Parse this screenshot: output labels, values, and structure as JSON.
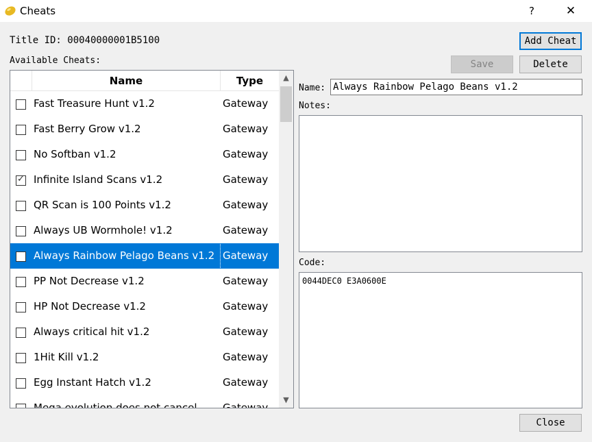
{
  "window": {
    "title": "Cheats",
    "help_glyph": "?",
    "close_glyph": "✕"
  },
  "title_id": "Title ID: 00040000001B5100",
  "available_label": "Available Cheats:",
  "buttons": {
    "add": "Add Cheat",
    "save": "Save",
    "delete": "Delete",
    "close": "Close"
  },
  "columns": {
    "name": "Name",
    "type": "Type"
  },
  "cheats": [
    {
      "name": "Fast Treasure Hunt v1.2",
      "type": "Gateway",
      "checked": false,
      "selected": false
    },
    {
      "name": "Fast Berry Grow v1.2",
      "type": "Gateway",
      "checked": false,
      "selected": false
    },
    {
      "name": "No Softban v1.2",
      "type": "Gateway",
      "checked": false,
      "selected": false
    },
    {
      "name": "Infinite Island Scans v1.2",
      "type": "Gateway",
      "checked": true,
      "selected": false
    },
    {
      "name": "QR Scan is 100 Points v1.2",
      "type": "Gateway",
      "checked": false,
      "selected": false
    },
    {
      "name": "Always UB Wormhole! v1.2",
      "type": "Gateway",
      "checked": false,
      "selected": false
    },
    {
      "name": "Always Rainbow Pelago Beans v1.2",
      "type": "Gateway",
      "checked": false,
      "selected": true
    },
    {
      "name": "PP Not Decrease v1.2",
      "type": "Gateway",
      "checked": false,
      "selected": false
    },
    {
      "name": "HP Not Decrease v1.2",
      "type": "Gateway",
      "checked": false,
      "selected": false
    },
    {
      "name": "Always critical hit v1.2",
      "type": "Gateway",
      "checked": false,
      "selected": false
    },
    {
      "name": "1Hit Kill v1.2",
      "type": "Gateway",
      "checked": false,
      "selected": false
    },
    {
      "name": "Egg Instant Hatch v1.2",
      "type": "Gateway",
      "checked": false,
      "selected": false
    },
    {
      "name": "Mega evolution does not cancel",
      "type": "Gateway",
      "checked": false,
      "selected": false
    }
  ],
  "scrollbar": {
    "up_glyph": "▲",
    "down_glyph": "▼"
  },
  "details": {
    "name_label": "Name:",
    "name_value": "Always Rainbow Pelago Beans v1.2",
    "notes_label": "Notes:",
    "notes_value": "",
    "code_label": "Code:",
    "code_value": "0044DEC0 E3A0600E"
  },
  "colors": {
    "selection": "#0078d7",
    "window_bg": "#f0f0f0",
    "icon": "#e8b923"
  }
}
